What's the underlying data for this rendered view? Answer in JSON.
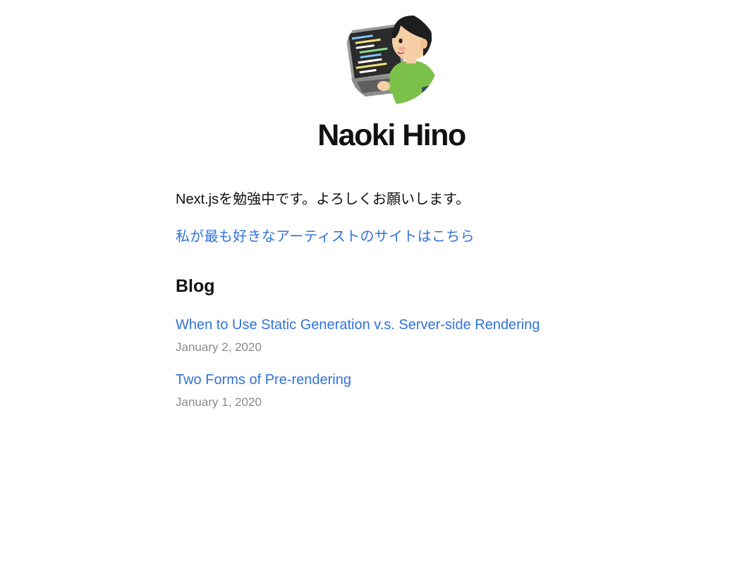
{
  "profile": {
    "name": "Naoki Hino",
    "intro": "Next.jsを勉強中です。よろしくお願いします。",
    "artist_link": "私が最も好きなアーティストのサイトはこちら"
  },
  "blog": {
    "heading": "Blog",
    "posts": [
      {
        "title": "When to Use Static Generation v.s. Server-side Rendering",
        "date": "January 2, 2020"
      },
      {
        "title": "Two Forms of Pre-rendering",
        "date": "January 1, 2020"
      }
    ]
  },
  "colors": {
    "link": "#3273d8",
    "date": "#8a8a8a",
    "text": "#111111"
  }
}
